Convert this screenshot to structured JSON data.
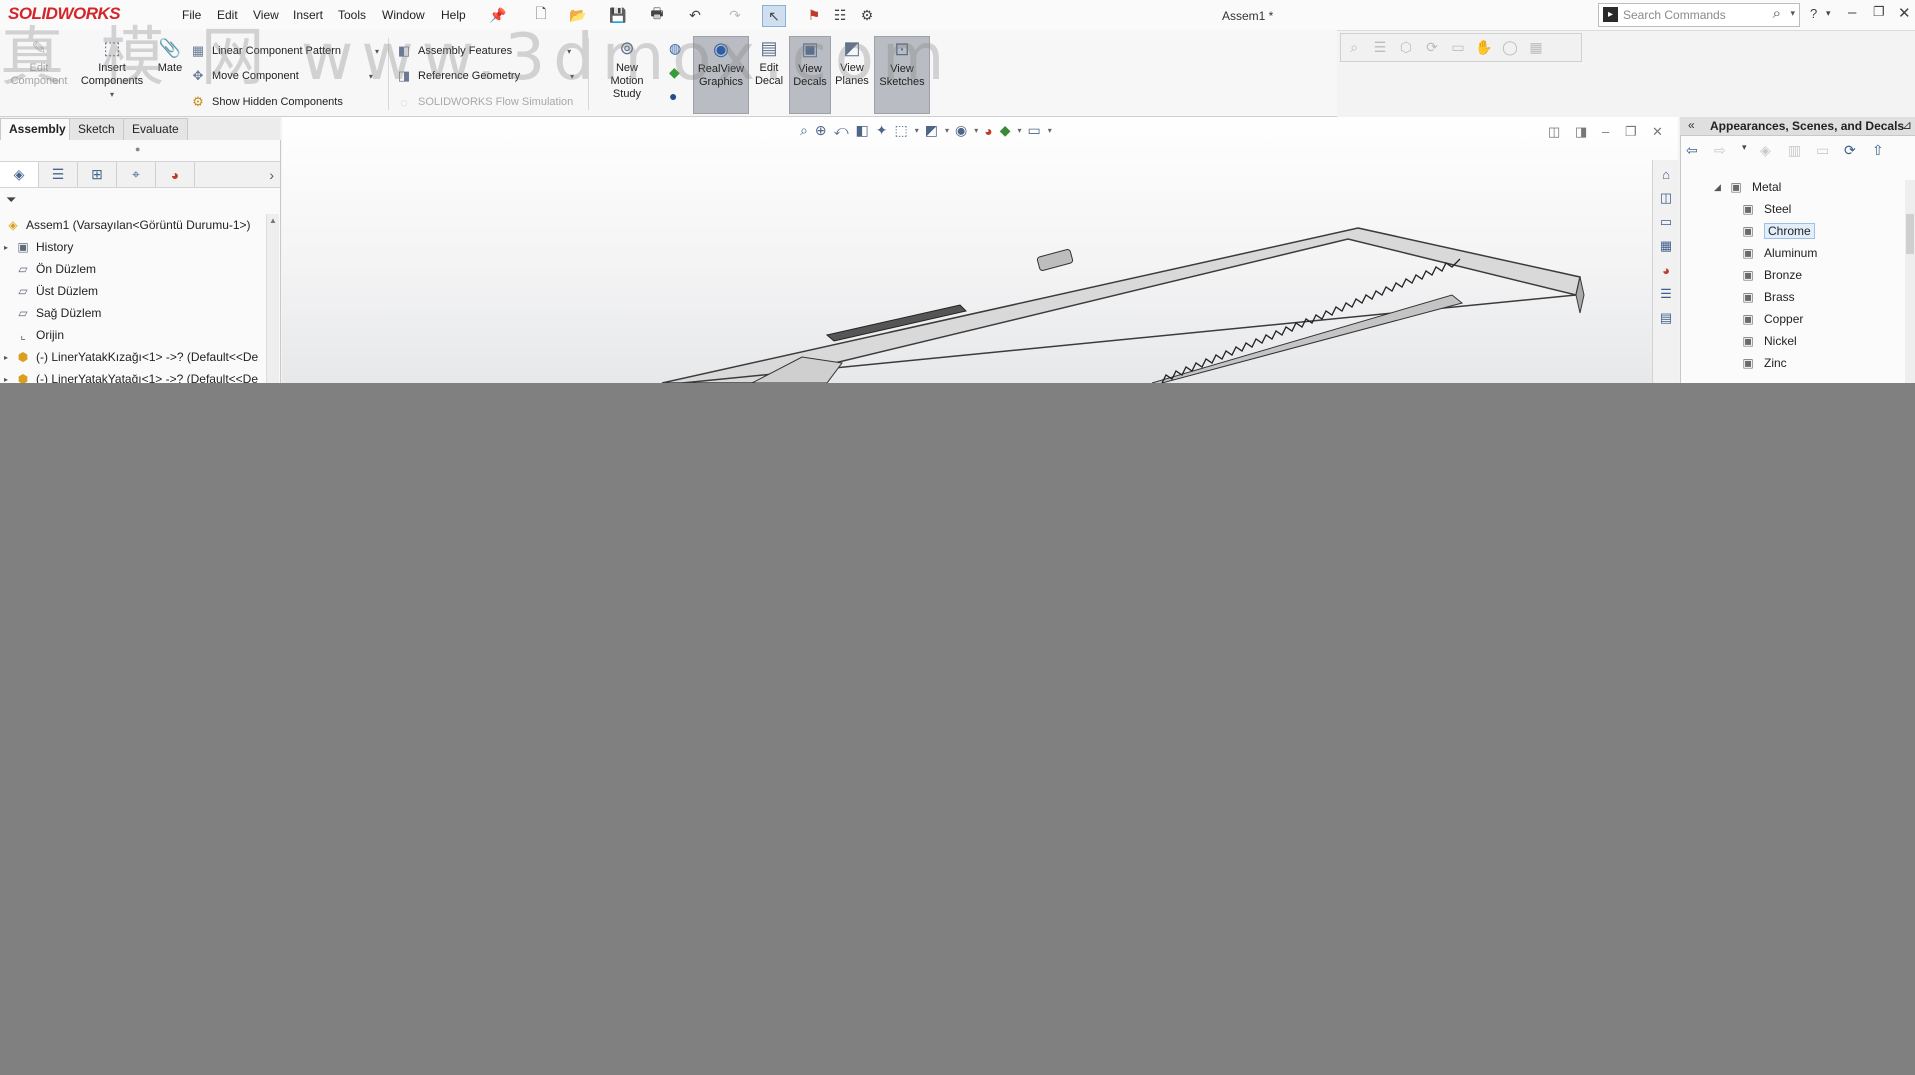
{
  "app": {
    "logo": "SOLIDWORKS",
    "document_title": "Assem1 *",
    "search_placeholder": "Search Commands",
    "help_icon": "?"
  },
  "menu": [
    "File",
    "Edit",
    "View",
    "Insert",
    "Tools",
    "Window",
    "Help"
  ],
  "command_manager": {
    "edit_component": "Edit\nComponent",
    "insert_components": "Insert\nComponents",
    "mate": "Mate",
    "linear_pattern": "Linear Component Pattern",
    "move_component": "Move Component",
    "show_hidden": "Show Hidden Components",
    "assembly_features": "Assembly Features",
    "reference_geometry": "Reference Geometry",
    "flow_simulation": "SOLIDWORKS Flow Simulation",
    "new_motion_study": "New\nMotion\nStudy",
    "realview": "RealView\nGraphics",
    "edit_decal": "Edit\nDecal",
    "view_decals": "View\nDecals",
    "view_planes": "View\nPlanes",
    "view_sketches": "View\nSketches"
  },
  "tabs": [
    "Assembly",
    "Sketch",
    "Evaluate"
  ],
  "active_tab": "Assembly",
  "feature_tree": {
    "root": "Assem1  (Varsayılan<Görüntü Durumu-1>)",
    "items": [
      {
        "label": "History",
        "icon": "history-icon",
        "expandable": true
      },
      {
        "label": "Ön Düzlem",
        "icon": "plane-icon",
        "expandable": false
      },
      {
        "label": "Üst Düzlem",
        "icon": "plane-icon",
        "expandable": false
      },
      {
        "label": "Sağ Düzlem",
        "icon": "plane-icon",
        "expandable": false
      },
      {
        "label": "Orijin",
        "icon": "origin-icon",
        "expandable": false
      },
      {
        "label": "(-) LinerYatakKızağı<1> ->? (Default<<De",
        "icon": "part-icon",
        "expandable": true
      },
      {
        "label": "(-) LinerYatakYatağı<1> ->? (Default<<De",
        "icon": "part-icon",
        "expandable": true
      }
    ]
  },
  "appearances_panel": {
    "title": "Appearances, Scenes, and Decals",
    "folder": "Metal",
    "items": [
      "Steel",
      "Chrome",
      "Aluminum",
      "Bronze",
      "Brass",
      "Copper",
      "Nickel",
      "Zinc"
    ],
    "selected": "Chrome"
  },
  "watermark": "真 模 网 www.3dmox.com"
}
